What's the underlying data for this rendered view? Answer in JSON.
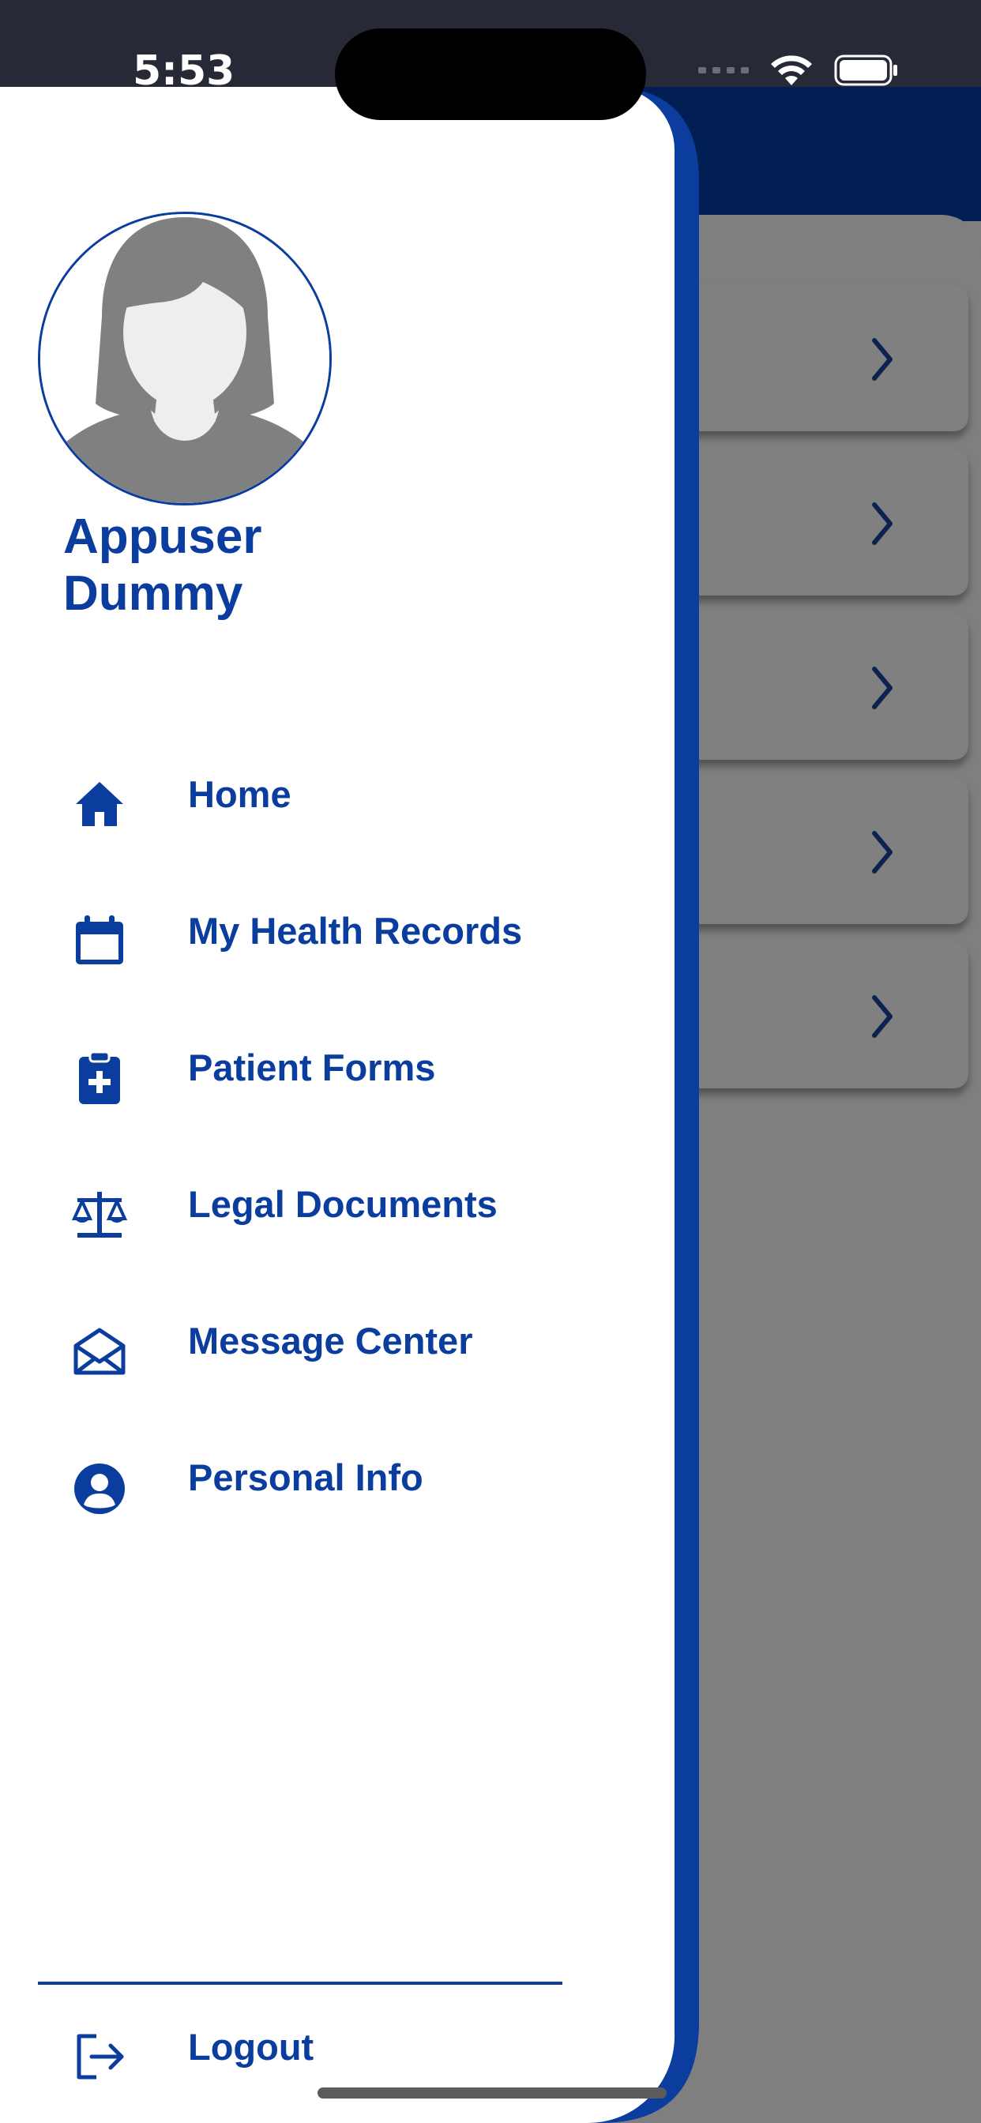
{
  "status_bar": {
    "time": "5:53"
  },
  "background_screen": {
    "header_title_fragment": "s",
    "card_count": 5
  },
  "drawer": {
    "user": {
      "first_name": "Appuser",
      "last_name": "Dummy"
    },
    "menu_items": [
      {
        "label": "Home",
        "icon": "home-icon"
      },
      {
        "label": "My Health Records",
        "icon": "calendar-icon"
      },
      {
        "label": "Patient Forms",
        "icon": "clipboard-medical-icon"
      },
      {
        "label": "Legal Documents",
        "icon": "scale-icon"
      },
      {
        "label": "Message Center",
        "icon": "envelope-open-icon"
      },
      {
        "label": "Personal Info",
        "icon": "user-circle-icon"
      }
    ],
    "logout": {
      "label": "Logout",
      "icon": "logout-icon"
    }
  },
  "colors": {
    "accent": "#0a3d9e",
    "header_navy": "#021f55",
    "overlay_gray": "#7f7f7f",
    "status_bar": "#272a36"
  }
}
